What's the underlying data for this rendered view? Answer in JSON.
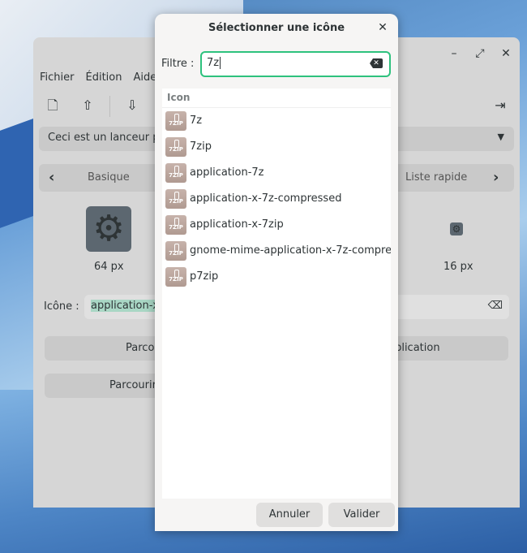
{
  "app": {
    "menu": [
      "Fichier",
      "Édition",
      "Aide"
    ],
    "combo_text": "Ceci est un lanceur p",
    "tabs": {
      "left": "Basique",
      "right": "Liste rapide"
    },
    "sizes": {
      "big": "64 px",
      "small": "16 px"
    },
    "icon_label": "Icône :",
    "icon_value": "application-x",
    "buttons": {
      "browse": "Parcourir",
      "from_app": "ar application",
      "browse_themes": "Parcourir les th"
    }
  },
  "dialog": {
    "title": "Sélectionner une icône",
    "filter_label": "Filtre :",
    "filter_value": "7z",
    "list_header": "Icon",
    "items": [
      {
        "name": "7z",
        "icon": "7zip-archive-icon"
      },
      {
        "name": "7zip",
        "icon": "7zip-archive-icon"
      },
      {
        "name": "application-7z",
        "icon": "7zip-archive-icon"
      },
      {
        "name": "application-x-7z-compressed",
        "icon": "7zip-archive-icon"
      },
      {
        "name": "application-x-7zip",
        "icon": "7zip-archive-icon"
      },
      {
        "name": "gnome-mime-application-x-7z-compre",
        "icon": "7zip-archive-icon"
      },
      {
        "name": "p7zip",
        "icon": "7zip-archive-icon"
      }
    ],
    "icon_badge": "7ZIP",
    "cancel_label": "Annuler",
    "ok_label": "Valider"
  },
  "colors": {
    "accent": "#2ec27e",
    "selection": "#a9d7c5"
  }
}
